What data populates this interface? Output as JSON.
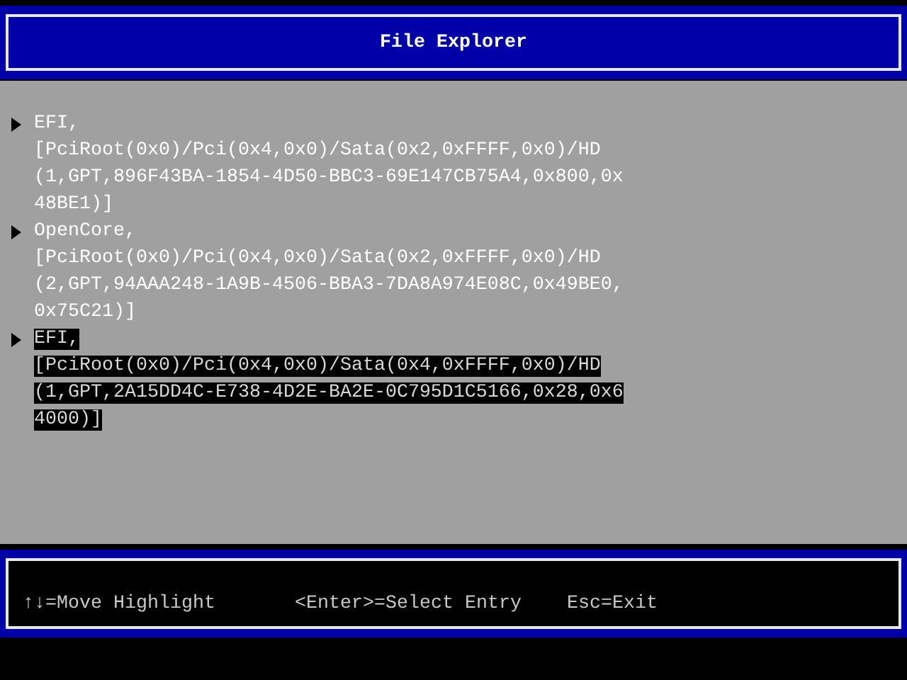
{
  "window": {
    "title": "File Explorer"
  },
  "entries": [
    {
      "name": "EFI,",
      "path": "[PciRoot(0x0)/Pci(0x4,0x0)/Sata(0x2,0xFFFF,0x0)/HD(1,GPT,896F43BA-1854-4D50-BBC3-69E147CB75A4,0x800,0x48BE1)]",
      "selected": false
    },
    {
      "name": "OpenCore,",
      "path": "[PciRoot(0x0)/Pci(0x4,0x0)/Sata(0x2,0xFFFF,0x0)/HD(2,GPT,94AAA248-1A9B-4506-BBA3-7DA8A974E08C,0x49BE0,0x75C21)]",
      "selected": false
    },
    {
      "name": "EFI,",
      "path": "[PciRoot(0x0)/Pci(0x4,0x0)/Sata(0x4,0xFFFF,0x0)/HD(1,GPT,2A15DD4C-E738-4D2E-BA2E-0C795D1C5166,0x28,0x64000)]",
      "selected": true
    }
  ],
  "help_bar": [
    "↑↓=Move Highlight",
    "<Enter>=Select Entry",
    "Esc=Exit"
  ]
}
